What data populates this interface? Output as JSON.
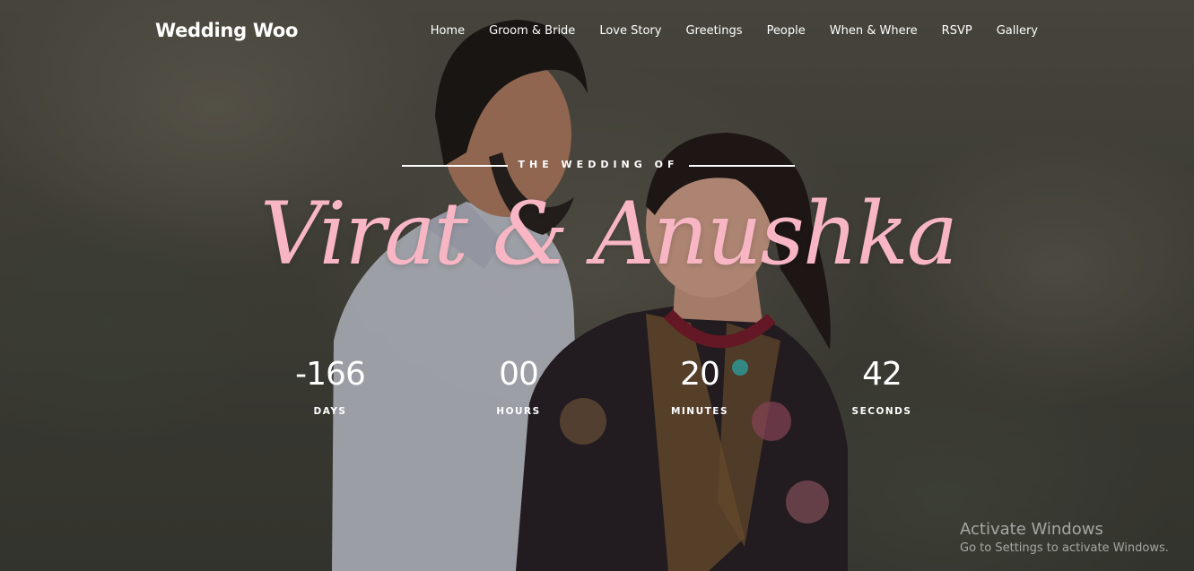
{
  "nav": {
    "brand": "Wedding Woo",
    "items": [
      {
        "label": "Home"
      },
      {
        "label": "Groom & Bride"
      },
      {
        "label": "Love Story"
      },
      {
        "label": "Greetings"
      },
      {
        "label": "People"
      },
      {
        "label": "When & Where"
      },
      {
        "label": "RSVP"
      },
      {
        "label": "Gallery"
      }
    ]
  },
  "hero": {
    "subtitle": "THE WEDDING OF",
    "names": "Virat & Anushka",
    "name_color": "#f8b6c4"
  },
  "countdown": {
    "days": {
      "value": "-166",
      "label": "DAYS"
    },
    "hours": {
      "value": "00",
      "label": "HOURS"
    },
    "minutes": {
      "value": "20",
      "label": "MINUTES"
    },
    "seconds": {
      "value": "42",
      "label": "SECONDS"
    }
  },
  "watermark": {
    "title": "Activate Windows",
    "subtitle": "Go to Settings to activate Windows."
  }
}
